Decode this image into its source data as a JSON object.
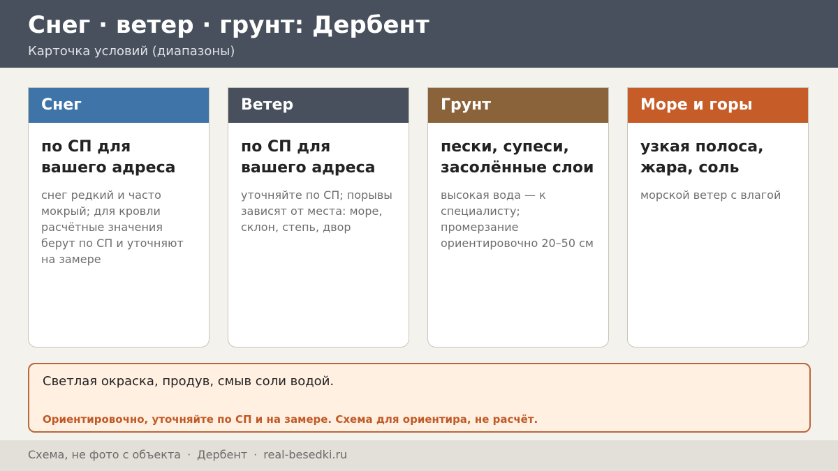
{
  "header": {
    "title": "Снег · ветер · грунт: Дербент",
    "subtitle": "Карточка условий (диапазоны)",
    "background_color": "#47505c"
  },
  "cards": [
    {
      "title": "Снег",
      "main": "по СП для вашего адреса",
      "note": "снег редкий и часто мокрый; для кровли расчётные значения берут по СП и уточняют на замере",
      "color": "#3e74a8"
    },
    {
      "title": "Ветер",
      "main": "по СП для вашего адреса",
      "note": "уточняйте по СП; порывы зависят от места: море, склон, степь, двор",
      "color": "#47505c"
    },
    {
      "title": "Грунт",
      "main": "пески, супеси, засолённые слои",
      "note": "высокая вода — к специалисту; промерзание ориентировочно 20–50 см",
      "color": "#8b633b"
    },
    {
      "title": "Море и горы",
      "main": "узкая полоса, жара, соль",
      "note": "морской ветер с влагой",
      "color": "#c65c28"
    }
  ],
  "note_box": {
    "text": "Светлая окраска, продув, смыв соли водой.",
    "warning": "Ориентировочно, уточняйте по СП и на замере. Схема для ориентира, не расчёт.",
    "background_color": "#fff0e2",
    "border_color": "#b9673a",
    "warning_color": "#c05a26"
  },
  "footer": {
    "part1": "Схема, не фото с объекта",
    "separator": "·",
    "part2": "Дербент",
    "part3": "real-besedki.ru"
  }
}
